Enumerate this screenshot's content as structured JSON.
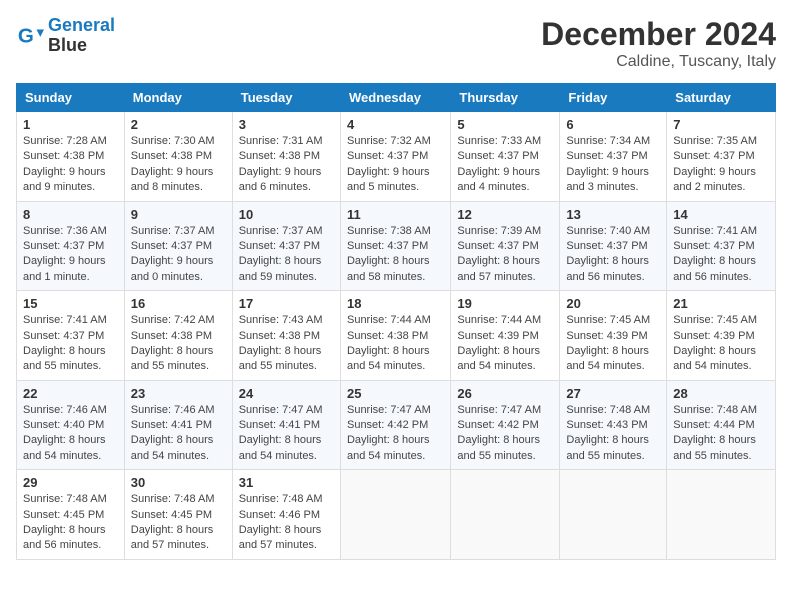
{
  "header": {
    "logo_line1": "General",
    "logo_line2": "Blue",
    "title": "December 2024",
    "subtitle": "Caldine, Tuscany, Italy"
  },
  "columns": [
    "Sunday",
    "Monday",
    "Tuesday",
    "Wednesday",
    "Thursday",
    "Friday",
    "Saturday"
  ],
  "weeks": [
    [
      {
        "day": "1",
        "sunrise": "7:28 AM",
        "sunset": "4:38 PM",
        "daylight": "9 hours and 9 minutes."
      },
      {
        "day": "2",
        "sunrise": "7:30 AM",
        "sunset": "4:38 PM",
        "daylight": "9 hours and 8 minutes."
      },
      {
        "day": "3",
        "sunrise": "7:31 AM",
        "sunset": "4:38 PM",
        "daylight": "9 hours and 6 minutes."
      },
      {
        "day": "4",
        "sunrise": "7:32 AM",
        "sunset": "4:37 PM",
        "daylight": "9 hours and 5 minutes."
      },
      {
        "day": "5",
        "sunrise": "7:33 AM",
        "sunset": "4:37 PM",
        "daylight": "9 hours and 4 minutes."
      },
      {
        "day": "6",
        "sunrise": "7:34 AM",
        "sunset": "4:37 PM",
        "daylight": "9 hours and 3 minutes."
      },
      {
        "day": "7",
        "sunrise": "7:35 AM",
        "sunset": "4:37 PM",
        "daylight": "9 hours and 2 minutes."
      }
    ],
    [
      {
        "day": "8",
        "sunrise": "7:36 AM",
        "sunset": "4:37 PM",
        "daylight": "9 hours and 1 minute."
      },
      {
        "day": "9",
        "sunrise": "7:37 AM",
        "sunset": "4:37 PM",
        "daylight": "9 hours and 0 minutes."
      },
      {
        "day": "10",
        "sunrise": "7:37 AM",
        "sunset": "4:37 PM",
        "daylight": "8 hours and 59 minutes."
      },
      {
        "day": "11",
        "sunrise": "7:38 AM",
        "sunset": "4:37 PM",
        "daylight": "8 hours and 58 minutes."
      },
      {
        "day": "12",
        "sunrise": "7:39 AM",
        "sunset": "4:37 PM",
        "daylight": "8 hours and 57 minutes."
      },
      {
        "day": "13",
        "sunrise": "7:40 AM",
        "sunset": "4:37 PM",
        "daylight": "8 hours and 56 minutes."
      },
      {
        "day": "14",
        "sunrise": "7:41 AM",
        "sunset": "4:37 PM",
        "daylight": "8 hours and 56 minutes."
      }
    ],
    [
      {
        "day": "15",
        "sunrise": "7:41 AM",
        "sunset": "4:37 PM",
        "daylight": "8 hours and 55 minutes."
      },
      {
        "day": "16",
        "sunrise": "7:42 AM",
        "sunset": "4:38 PM",
        "daylight": "8 hours and 55 minutes."
      },
      {
        "day": "17",
        "sunrise": "7:43 AM",
        "sunset": "4:38 PM",
        "daylight": "8 hours and 55 minutes."
      },
      {
        "day": "18",
        "sunrise": "7:44 AM",
        "sunset": "4:38 PM",
        "daylight": "8 hours and 54 minutes."
      },
      {
        "day": "19",
        "sunrise": "7:44 AM",
        "sunset": "4:39 PM",
        "daylight": "8 hours and 54 minutes."
      },
      {
        "day": "20",
        "sunrise": "7:45 AM",
        "sunset": "4:39 PM",
        "daylight": "8 hours and 54 minutes."
      },
      {
        "day": "21",
        "sunrise": "7:45 AM",
        "sunset": "4:39 PM",
        "daylight": "8 hours and 54 minutes."
      }
    ],
    [
      {
        "day": "22",
        "sunrise": "7:46 AM",
        "sunset": "4:40 PM",
        "daylight": "8 hours and 54 minutes."
      },
      {
        "day": "23",
        "sunrise": "7:46 AM",
        "sunset": "4:41 PM",
        "daylight": "8 hours and 54 minutes."
      },
      {
        "day": "24",
        "sunrise": "7:47 AM",
        "sunset": "4:41 PM",
        "daylight": "8 hours and 54 minutes."
      },
      {
        "day": "25",
        "sunrise": "7:47 AM",
        "sunset": "4:42 PM",
        "daylight": "8 hours and 54 minutes."
      },
      {
        "day": "26",
        "sunrise": "7:47 AM",
        "sunset": "4:42 PM",
        "daylight": "8 hours and 55 minutes."
      },
      {
        "day": "27",
        "sunrise": "7:48 AM",
        "sunset": "4:43 PM",
        "daylight": "8 hours and 55 minutes."
      },
      {
        "day": "28",
        "sunrise": "7:48 AM",
        "sunset": "4:44 PM",
        "daylight": "8 hours and 55 minutes."
      }
    ],
    [
      {
        "day": "29",
        "sunrise": "7:48 AM",
        "sunset": "4:45 PM",
        "daylight": "8 hours and 56 minutes."
      },
      {
        "day": "30",
        "sunrise": "7:48 AM",
        "sunset": "4:45 PM",
        "daylight": "8 hours and 57 minutes."
      },
      {
        "day": "31",
        "sunrise": "7:48 AM",
        "sunset": "4:46 PM",
        "daylight": "8 hours and 57 minutes."
      },
      null,
      null,
      null,
      null
    ]
  ]
}
